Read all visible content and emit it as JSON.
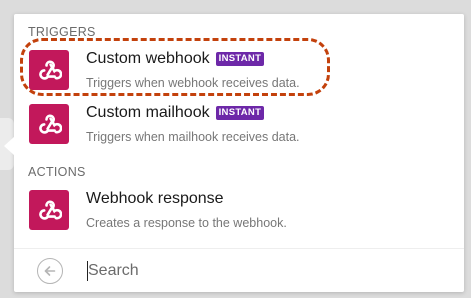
{
  "colors": {
    "app_icon_bg": "#c2185b",
    "badge_bg": "#6d28a8",
    "highlight": "#c3410c"
  },
  "triggers": {
    "label": "TRIGGERS",
    "items": [
      {
        "title": "Custom webhook",
        "badge": "INSTANT",
        "description": "Triggers when webhook receives data.",
        "icon": "webhook-icon"
      },
      {
        "title": "Custom mailhook",
        "badge": "INSTANT",
        "description": "Triggers when mailhook receives data.",
        "icon": "webhook-icon"
      }
    ]
  },
  "actions": {
    "label": "ACTIONS",
    "items": [
      {
        "title": "Webhook response",
        "description": "Creates a response to the webhook.",
        "icon": "webhook-icon"
      }
    ]
  },
  "search": {
    "placeholder": "Search",
    "back_icon": "arrow-left-circle-icon"
  }
}
